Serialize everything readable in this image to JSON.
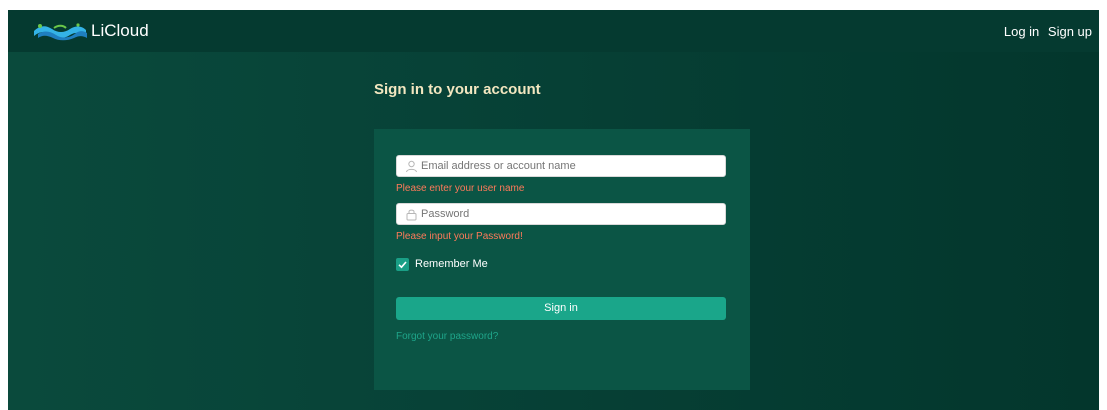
{
  "header": {
    "brand": "LiCloud",
    "login_link": "Log in",
    "signup_link": "Sign up",
    "logo_icon": "licloud-wave-logo"
  },
  "page": {
    "title": "Sign in to your account"
  },
  "form": {
    "username": {
      "value": "",
      "placeholder": "Email address or account name",
      "icon": "user-icon",
      "error": "Please enter your user name"
    },
    "password": {
      "value": "",
      "placeholder": "Password",
      "icon": "lock-icon",
      "error": "Please input your Password!"
    },
    "remember": {
      "label": "Remember Me",
      "checked": true
    },
    "submit_label": "Sign in",
    "forgot_label": "Forgot your password?"
  },
  "colors": {
    "background": "#074237",
    "card": "#0b5545",
    "accent": "#1aa68a",
    "title": "#f3e7c0",
    "error": "#ff7a5a"
  }
}
